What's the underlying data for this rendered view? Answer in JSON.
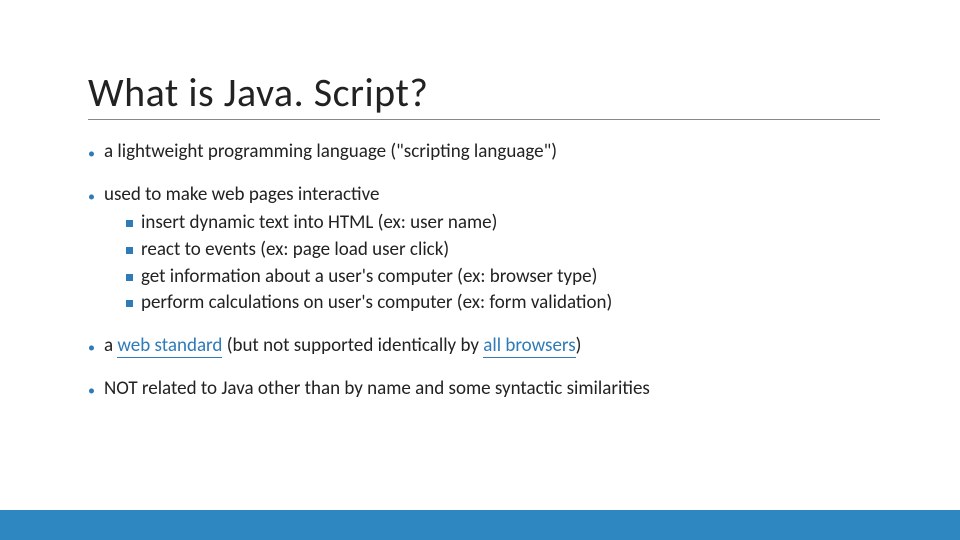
{
  "title": "What is Java. Script?",
  "bullets": [
    {
      "text": "a lightweight programming language (\"scripting language\")"
    },
    {
      "text": "used to make web pages interactive",
      "subs": [
        "insert dynamic text into HTML (ex: user name)",
        "react to events (ex: page load user click)",
        "get information about a user's computer (ex: browser type)",
        "perform calculations on user's computer (ex: form validation)"
      ]
    },
    {
      "segments": [
        {
          "text": "a ",
          "link": false
        },
        {
          "text": "web standard",
          "link": true
        },
        {
          "text": " (but not supported identically by ",
          "link": false
        },
        {
          "text": "all browsers",
          "link": true
        },
        {
          "text": ")",
          "link": false
        }
      ]
    },
    {
      "text": "NOT related to Java other than by name and some syntactic similarities"
    }
  ],
  "colors": {
    "accent": "#2e7bb8",
    "footer": "#2f87c2"
  }
}
